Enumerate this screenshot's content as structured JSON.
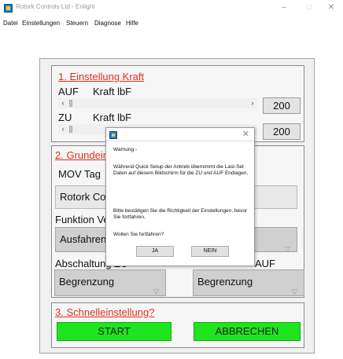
{
  "window": {
    "title": "Rotork Controls Ltd - Enlight",
    "minimize": "–",
    "maximize": "□",
    "close": "✕"
  },
  "menu": [
    "Datei",
    "Einstellungen",
    "Steuern",
    "Diagnose",
    "Hilfe"
  ],
  "section1": {
    "title": "1. Einstellung Kraft",
    "auf_label": "AUF",
    "auf_kraft_label": "Kraft lbF",
    "auf_value": "200",
    "zu_label": "ZU",
    "zu_kraft_label": "Kraft lbF",
    "zu_value": "200"
  },
  "section2": {
    "title": "2. Grundeinstellungen",
    "mov_tag_label": "MOV Tag",
    "mov_tag_value": "Rotork Controls",
    "funktion_label": "Funktion Ventil",
    "funktion_value": "Ausfahren",
    "abschaltung_label": "Abschaltung ZU",
    "abschaltung_auf_label": "AUF",
    "zu_dropdown_value": "Begrenzung",
    "auf_dropdown_value": "Begrenzung"
  },
  "section3": {
    "title": "3. Schnelleinstellung?",
    "start_label": "START",
    "cancel_label": "ABBRECHEN"
  },
  "dialog": {
    "title": "Warnung -",
    "message1": "Während Quick Setup der Antrieb übernimmt die Last-Set Daten auf diesem Bildschirm für die ZU und AUF Endlagen.",
    "message2": "Bitte bestätigen Sie die Richtigkeit der Einstellungen, bevor Sie fortfahren.",
    "question": "Wollen Sie fortfahren?",
    "yes_label": "JA",
    "no_label": "NEIN",
    "close": "✕"
  },
  "colors": {
    "accent_red": "#e0301e",
    "button_green": "#1fe51f"
  }
}
